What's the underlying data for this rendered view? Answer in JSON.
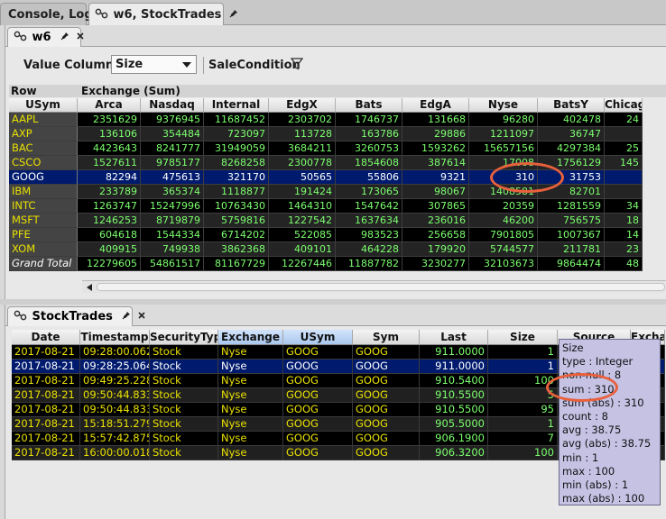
{
  "top_tabs": {
    "console": "Console, Log",
    "stocktrades": "w6, StockTrades"
  },
  "pivot_panel": {
    "tab_label": "w6",
    "value_column_label": "Value Column:",
    "value_column_selected": "Size",
    "sale_condition_label": "SaleCondition",
    "row_header": "Row",
    "exchange_header": "Exchange (Sum)",
    "columns": [
      "USym",
      "Arca",
      "Nasdaq",
      "Internal",
      "EdgX",
      "Bats",
      "EdgA",
      "Nyse",
      "BatsY",
      "Chicago"
    ],
    "rows": [
      {
        "key": "AAPL",
        "vals": [
          "2351629",
          "9376945",
          "11687452",
          "2303702",
          "1746737",
          "131668",
          "96280",
          "402478",
          "24"
        ]
      },
      {
        "key": "AXP",
        "vals": [
          "136106",
          "354484",
          "723097",
          "113728",
          "163786",
          "29886",
          "1211097",
          "36747",
          ""
        ]
      },
      {
        "key": "BAC",
        "vals": [
          "4423643",
          "8241777",
          "31949059",
          "3684211",
          "3260753",
          "1593262",
          "15657156",
          "4297384",
          "25"
        ]
      },
      {
        "key": "CSCO",
        "vals": [
          "1527611",
          "9785177",
          "8268258",
          "2300778",
          "1854608",
          "387614",
          "17008",
          "1756129",
          "145"
        ]
      },
      {
        "key": "GOOG",
        "vals": [
          "82294",
          "475613",
          "321170",
          "50565",
          "55806",
          "9321",
          "310",
          "31753",
          ""
        ]
      },
      {
        "key": "IBM",
        "vals": [
          "233789",
          "365374",
          "1118877",
          "191424",
          "173065",
          "98067",
          "1408581",
          "82701",
          ""
        ]
      },
      {
        "key": "INTC",
        "vals": [
          "1263747",
          "15247996",
          "10763430",
          "1464310",
          "1547642",
          "307865",
          "20359",
          "1281559",
          "34"
        ]
      },
      {
        "key": "MSFT",
        "vals": [
          "1246253",
          "8719879",
          "5759816",
          "1227542",
          "1637634",
          "236016",
          "46200",
          "756575",
          "18"
        ]
      },
      {
        "key": "PFE",
        "vals": [
          "604618",
          "1544334",
          "6714202",
          "522085",
          "983523",
          "256658",
          "7901805",
          "1007367",
          "14"
        ]
      },
      {
        "key": "XOM",
        "vals": [
          "409915",
          "749938",
          "3862368",
          "409101",
          "464228",
          "179920",
          "5744577",
          "211781",
          "23"
        ]
      }
    ],
    "grand_total": {
      "key": "Grand Total",
      "vals": [
        "12279605",
        "54861517",
        "81167729",
        "12267446",
        "11887782",
        "3230277",
        "32103673",
        "9864474",
        "48"
      ]
    }
  },
  "table_panel": {
    "tab_label": "StockTrades",
    "columns": [
      "Date",
      "Timestamp",
      "SecurityType",
      "Exchange",
      "USym",
      "Sym",
      "Last",
      "Size",
      "Source",
      "Exchange"
    ],
    "rows": [
      {
        "date": "2017-08-21",
        "ts": "09:28:00.062",
        "sec": "Stock",
        "exch": "Nyse",
        "usym": "GOOG",
        "sym": "GOOG",
        "last": "911.0000",
        "size": "1"
      },
      {
        "date": "2017-08-21",
        "ts": "09:28:25.064",
        "sec": "Stock",
        "exch": "Nyse",
        "usym": "GOOG",
        "sym": "GOOG",
        "last": "911.0000",
        "size": "1"
      },
      {
        "date": "2017-08-21",
        "ts": "09:49:25.228",
        "sec": "Stock",
        "exch": "Nyse",
        "usym": "GOOG",
        "sym": "GOOG",
        "last": "910.5400",
        "size": "100"
      },
      {
        "date": "2017-08-21",
        "ts": "09:50:44.833",
        "sec": "Stock",
        "exch": "Nyse",
        "usym": "GOOG",
        "sym": "GOOG",
        "last": "910.5500",
        "size": "5"
      },
      {
        "date": "2017-08-21",
        "ts": "09:50:44.833",
        "sec": "Stock",
        "exch": "Nyse",
        "usym": "GOOG",
        "sym": "GOOG",
        "last": "910.5500",
        "size": "95"
      },
      {
        "date": "2017-08-21",
        "ts": "15:18:51.279",
        "sec": "Stock",
        "exch": "Nyse",
        "usym": "GOOG",
        "sym": "GOOG",
        "last": "905.5000",
        "size": "1"
      },
      {
        "date": "2017-08-21",
        "ts": "15:57:42.875",
        "sec": "Stock",
        "exch": "Nyse",
        "usym": "GOOG",
        "sym": "GOOG",
        "last": "906.1900",
        "size": "7"
      },
      {
        "date": "2017-08-21",
        "ts": "16:00:00.018",
        "sec": "Stock",
        "exch": "Nyse",
        "usym": "GOOG",
        "sym": "GOOG",
        "last": "906.3200",
        "size": "100"
      }
    ]
  },
  "tooltip": {
    "lines": [
      "Size",
      "type : Integer",
      "non-null : 8",
      "sum : 310",
      "sum (abs) : 310",
      "count : 8",
      "avg : 38.75",
      "avg (abs) : 38.75",
      "min : 1",
      "max : 100",
      "min (abs) : 1",
      "max (abs) : 100"
    ]
  },
  "colors": {
    "grid_bg": "#000000",
    "value_text": "#7cff6e",
    "key_text": "#e8e000",
    "selection": "#001b6e",
    "highlight_ring": "#e8603c",
    "tooltip_bg": "#c5c2e4"
  },
  "icons": {
    "tab_icon": "link-icon",
    "pin": "pin-icon",
    "close": "close-icon",
    "filter": "funnel-icon"
  }
}
